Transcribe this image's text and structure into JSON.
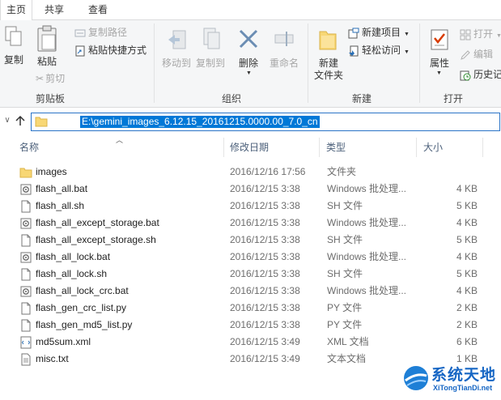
{
  "tabs": [
    "主页",
    "共享",
    "查看"
  ],
  "ribbon": {
    "clipboard": {
      "copy": "复制",
      "paste": "粘贴",
      "copy_path": "复制路径",
      "paste_shortcut": "粘贴快捷方式",
      "cut": "剪切",
      "label": "剪贴板"
    },
    "organize": {
      "move_to": "移动到",
      "copy_to": "复制到",
      "delete": "删除",
      "rename": "重命名",
      "label": "组织"
    },
    "new": {
      "new_folder_line1": "新建",
      "new_folder_line2": "文件夹",
      "new_item": "新建项目",
      "easy_access": "轻松访问",
      "label": "新建"
    },
    "open": {
      "properties": "属性",
      "open": "打开",
      "edit": "编辑",
      "history": "历史记",
      "label": "打开"
    }
  },
  "address": {
    "path": "E:\\gemini_images_6.12.15_20161215.0000.00_7.0_cn"
  },
  "columns": {
    "name": "名称",
    "date": "修改日期",
    "type": "类型",
    "size": "大小"
  },
  "files": [
    {
      "name": "images",
      "date": "2016/12/16 17:56",
      "type": "文件夹",
      "size": "",
      "icon": "folder-icon"
    },
    {
      "name": "flash_all.bat",
      "date": "2016/12/15 3:38",
      "type": "Windows 批处理...",
      "size": "4 KB",
      "icon": "batch-file-icon"
    },
    {
      "name": "flash_all.sh",
      "date": "2016/12/15 3:38",
      "type": "SH 文件",
      "size": "5 KB",
      "icon": "file-icon"
    },
    {
      "name": "flash_all_except_storage.bat",
      "date": "2016/12/15 3:38",
      "type": "Windows 批处理...",
      "size": "4 KB",
      "icon": "batch-file-icon"
    },
    {
      "name": "flash_all_except_storage.sh",
      "date": "2016/12/15 3:38",
      "type": "SH 文件",
      "size": "5 KB",
      "icon": "file-icon"
    },
    {
      "name": "flash_all_lock.bat",
      "date": "2016/12/15 3:38",
      "type": "Windows 批处理...",
      "size": "4 KB",
      "icon": "batch-file-icon"
    },
    {
      "name": "flash_all_lock.sh",
      "date": "2016/12/15 3:38",
      "type": "SH 文件",
      "size": "5 KB",
      "icon": "file-icon"
    },
    {
      "name": "flash_all_lock_crc.bat",
      "date": "2016/12/15 3:38",
      "type": "Windows 批处理...",
      "size": "4 KB",
      "icon": "batch-file-icon"
    },
    {
      "name": "flash_gen_crc_list.py",
      "date": "2016/12/15 3:38",
      "type": "PY 文件",
      "size": "2 KB",
      "icon": "file-icon"
    },
    {
      "name": "flash_gen_md5_list.py",
      "date": "2016/12/15 3:38",
      "type": "PY 文件",
      "size": "2 KB",
      "icon": "file-icon"
    },
    {
      "name": "md5sum.xml",
      "date": "2016/12/15 3:49",
      "type": "XML 文档",
      "size": "6 KB",
      "icon": "xml-file-icon"
    },
    {
      "name": "misc.txt",
      "date": "2016/12/15 3:49",
      "type": "文本文档",
      "size": "1 KB",
      "icon": "text-file-icon"
    }
  ],
  "watermark": {
    "title": "系统天地",
    "url": "XiTongTianDi.net"
  },
  "colors": {
    "selection": "#0078d7",
    "folder": "#f8d775",
    "delete_x": "#6b8db3",
    "header_text": "#4c607a"
  }
}
